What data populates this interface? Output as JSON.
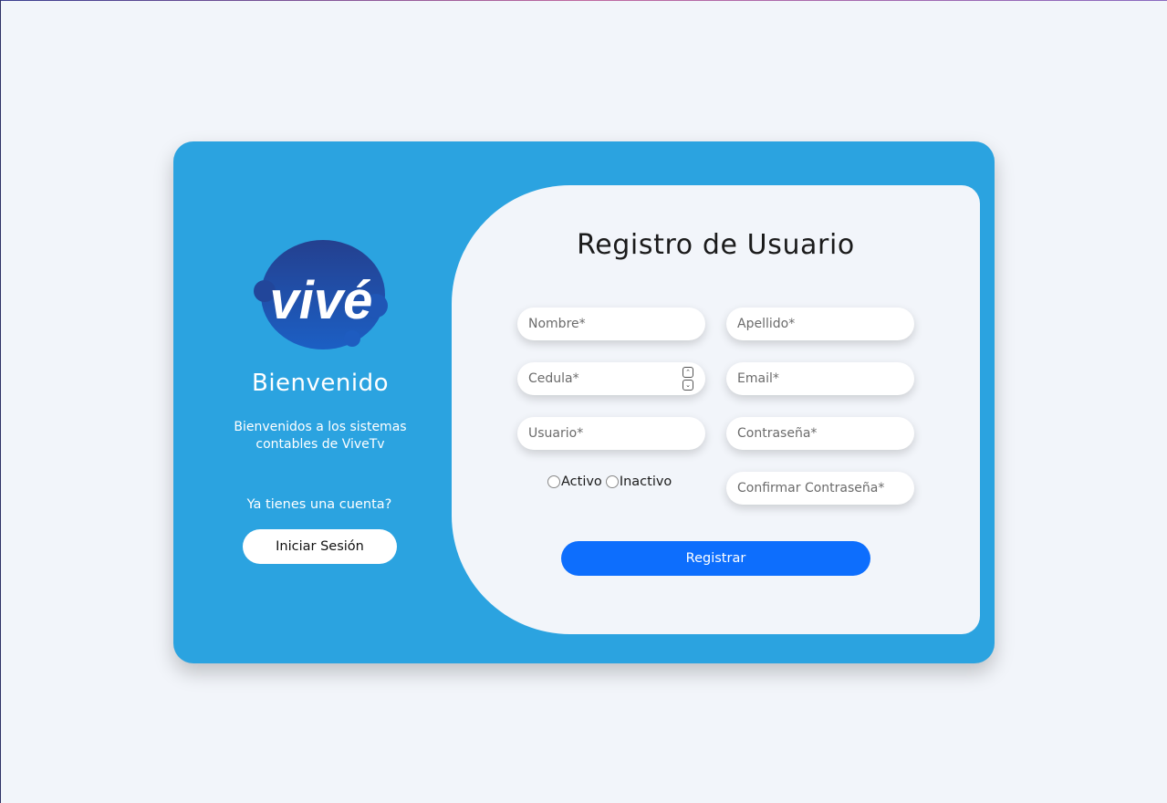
{
  "brand": {
    "logo_text": "vivé",
    "logo_color": "#1f4fa8",
    "primary_color": "#2ba3e0",
    "button_color": "#0d6efd"
  },
  "welcome": {
    "title": "Bienvenido",
    "text": "Bienvenidos a los sistemas contables de ViveTv",
    "account_question": "Ya tienes una cuenta?",
    "login_label": "Iniciar Sesión"
  },
  "form": {
    "title": "Registro de Usuario",
    "fields": {
      "nombre": "Nombre*",
      "apellido": "Apellido*",
      "cedula": "Cedula*",
      "email": "Email*",
      "usuario": "Usuario*",
      "contrasena": "Contraseña*",
      "confirmar": "Confirmar Contraseña*"
    },
    "status": {
      "activo": "Activo",
      "inactivo": "Inactivo"
    },
    "submit_label": "Registrar"
  }
}
